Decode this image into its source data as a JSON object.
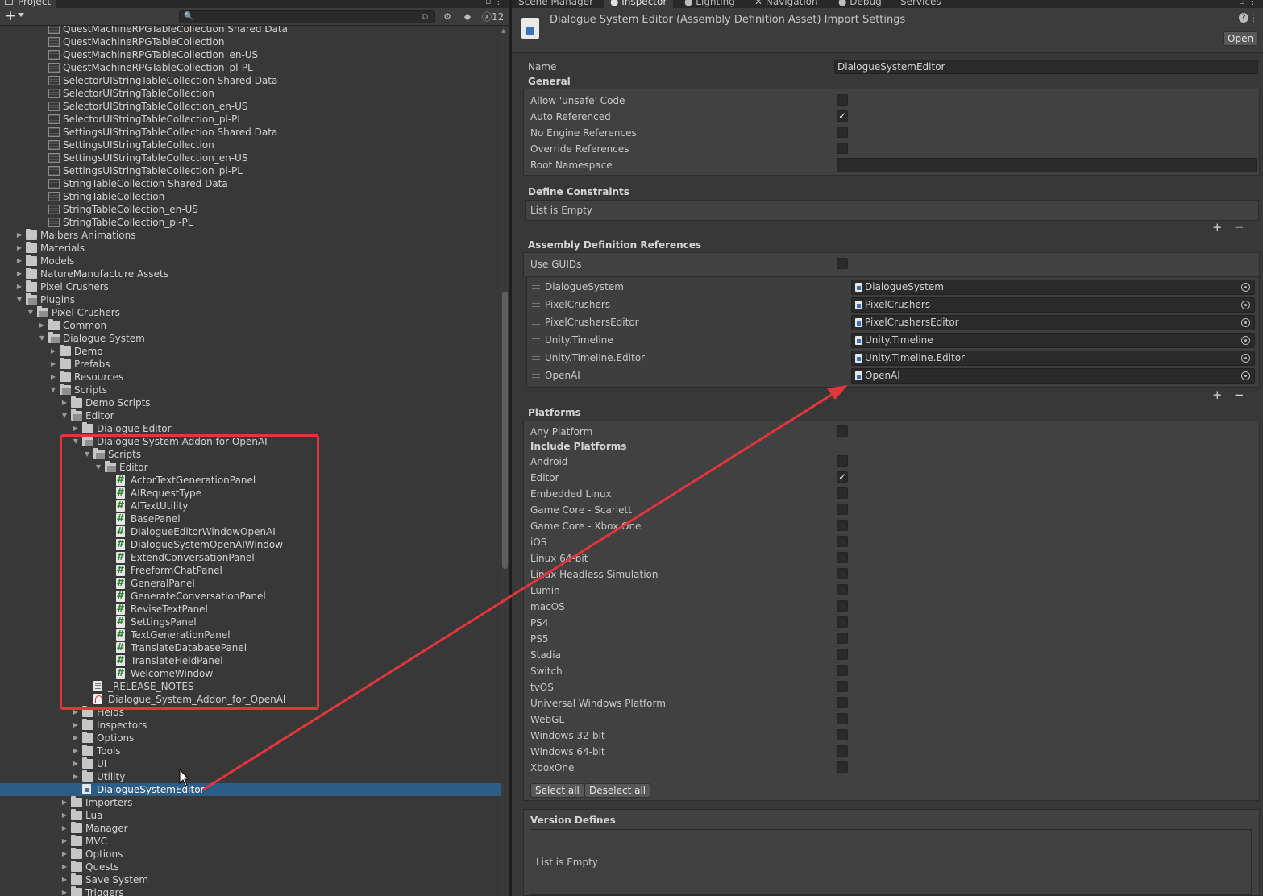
{
  "left_panel": {
    "tab_title": "Project",
    "hidden_count": "12",
    "tree": [
      {
        "label": "QuestMachineRPGTableCollection Shared Data",
        "icon": "table-icon",
        "depth": 3,
        "arrow": ""
      },
      {
        "label": "QuestMachineRPGTableCollection",
        "icon": "table-icon",
        "depth": 3,
        "arrow": ""
      },
      {
        "label": "QuestMachineRPGTableCollection_en-US",
        "icon": "table-icon",
        "depth": 3,
        "arrow": ""
      },
      {
        "label": "QuestMachineRPGTableCollection_pl-PL",
        "icon": "table-icon",
        "depth": 3,
        "arrow": ""
      },
      {
        "label": "SelectorUIStringTableCollection Shared Data",
        "icon": "table-icon",
        "depth": 3,
        "arrow": ""
      },
      {
        "label": "SelectorUIStringTableCollection",
        "icon": "table-icon",
        "depth": 3,
        "arrow": ""
      },
      {
        "label": "SelectorUIStringTableCollection_en-US",
        "icon": "table-icon",
        "depth": 3,
        "arrow": ""
      },
      {
        "label": "SelectorUIStringTableCollection_pl-PL",
        "icon": "table-icon",
        "depth": 3,
        "arrow": ""
      },
      {
        "label": "SettingsUIStringTableCollection Shared Data",
        "icon": "table-icon",
        "depth": 3,
        "arrow": ""
      },
      {
        "label": "SettingsUIStringTableCollection",
        "icon": "table-icon",
        "depth": 3,
        "arrow": ""
      },
      {
        "label": "SettingsUIStringTableCollection_en-US",
        "icon": "table-icon",
        "depth": 3,
        "arrow": ""
      },
      {
        "label": "SettingsUIStringTableCollection_pl-PL",
        "icon": "table-icon",
        "depth": 3,
        "arrow": ""
      },
      {
        "label": "StringTableCollection Shared Data",
        "icon": "table-icon",
        "depth": 3,
        "arrow": ""
      },
      {
        "label": "StringTableCollection",
        "icon": "table-icon",
        "depth": 3,
        "arrow": ""
      },
      {
        "label": "StringTableCollection_en-US",
        "icon": "table-icon",
        "depth": 3,
        "arrow": ""
      },
      {
        "label": "StringTableCollection_pl-PL",
        "icon": "table-icon",
        "depth": 3,
        "arrow": ""
      },
      {
        "label": "Malbers Animations",
        "icon": "folder-icon",
        "depth": 1,
        "arrow": "right"
      },
      {
        "label": "Materials",
        "icon": "folder-icon",
        "depth": 1,
        "arrow": "right"
      },
      {
        "label": "Models",
        "icon": "folder-icon",
        "depth": 1,
        "arrow": "right"
      },
      {
        "label": "NatureManufacture Assets",
        "icon": "folder-icon",
        "depth": 1,
        "arrow": "right"
      },
      {
        "label": "Pixel Crushers",
        "icon": "folder-icon",
        "depth": 1,
        "arrow": "right"
      },
      {
        "label": "Plugins",
        "icon": "folder-open-icon",
        "depth": 1,
        "arrow": "down"
      },
      {
        "label": "Pixel Crushers",
        "icon": "folder-open-icon",
        "depth": 2,
        "arrow": "down"
      },
      {
        "label": "Common",
        "icon": "folder-icon",
        "depth": 3,
        "arrow": "right"
      },
      {
        "label": "Dialogue System",
        "icon": "folder-open-icon",
        "depth": 3,
        "arrow": "down"
      },
      {
        "label": "Demo",
        "icon": "folder-icon",
        "depth": 4,
        "arrow": "right"
      },
      {
        "label": "Prefabs",
        "icon": "folder-icon",
        "depth": 4,
        "arrow": "right"
      },
      {
        "label": "Resources",
        "icon": "folder-icon",
        "depth": 4,
        "arrow": "right"
      },
      {
        "label": "Scripts",
        "icon": "folder-open-icon",
        "depth": 4,
        "arrow": "down"
      },
      {
        "label": "Demo Scripts",
        "icon": "folder-icon",
        "depth": 5,
        "arrow": "right"
      },
      {
        "label": "Editor",
        "icon": "folder-open-icon",
        "depth": 5,
        "arrow": "down"
      },
      {
        "label": "Dialogue Editor",
        "icon": "folder-icon",
        "depth": 6,
        "arrow": "right"
      },
      {
        "label": "Dialogue System Addon for OpenAI",
        "icon": "folder-open-icon",
        "depth": 6,
        "arrow": "down"
      },
      {
        "label": "Scripts",
        "icon": "folder-open-icon",
        "depth": 7,
        "arrow": "down"
      },
      {
        "label": "Editor",
        "icon": "folder-open-icon",
        "depth": 8,
        "arrow": "down"
      },
      {
        "label": "ActorTextGenerationPanel",
        "icon": "csharp-icon",
        "depth": 9,
        "arrow": ""
      },
      {
        "label": "AIRequestType",
        "icon": "csharp-icon",
        "depth": 9,
        "arrow": ""
      },
      {
        "label": "AITextUtility",
        "icon": "csharp-icon",
        "depth": 9,
        "arrow": ""
      },
      {
        "label": "BasePanel",
        "icon": "csharp-icon",
        "depth": 9,
        "arrow": ""
      },
      {
        "label": "DialogueEditorWindowOpenAI",
        "icon": "csharp-icon",
        "depth": 9,
        "arrow": ""
      },
      {
        "label": "DialogueSystemOpenAIWindow",
        "icon": "csharp-icon",
        "depth": 9,
        "arrow": ""
      },
      {
        "label": "ExtendConversationPanel",
        "icon": "csharp-icon",
        "depth": 9,
        "arrow": ""
      },
      {
        "label": "FreeformChatPanel",
        "icon": "csharp-icon",
        "depth": 9,
        "arrow": ""
      },
      {
        "label": "GeneralPanel",
        "icon": "csharp-icon",
        "depth": 9,
        "arrow": ""
      },
      {
        "label": "GenerateConversationPanel",
        "icon": "csharp-icon",
        "depth": 9,
        "arrow": ""
      },
      {
        "label": "ReviseTextPanel",
        "icon": "csharp-icon",
        "depth": 9,
        "arrow": ""
      },
      {
        "label": "SettingsPanel",
        "icon": "csharp-icon",
        "depth": 9,
        "arrow": ""
      },
      {
        "label": "TextGenerationPanel",
        "icon": "csharp-icon",
        "depth": 9,
        "arrow": ""
      },
      {
        "label": "TranslateDatabasePanel",
        "icon": "csharp-icon",
        "depth": 9,
        "arrow": ""
      },
      {
        "label": "TranslateFieldPanel",
        "icon": "csharp-icon",
        "depth": 9,
        "arrow": ""
      },
      {
        "label": "WelcomeWindow",
        "icon": "csharp-icon",
        "depth": 9,
        "arrow": ""
      },
      {
        "label": "_RELEASE_NOTES",
        "icon": "text-file-icon",
        "depth": 7,
        "arrow": ""
      },
      {
        "label": "Dialogue_System_Addon_for_OpenAI",
        "icon": "pdf-icon",
        "depth": 7,
        "arrow": ""
      },
      {
        "label": "Fields",
        "icon": "folder-icon",
        "depth": 6,
        "arrow": "right"
      },
      {
        "label": "Inspectors",
        "icon": "folder-icon",
        "depth": 6,
        "arrow": "right"
      },
      {
        "label": "Options",
        "icon": "folder-icon",
        "depth": 6,
        "arrow": "right"
      },
      {
        "label": "Tools",
        "icon": "folder-icon",
        "depth": 6,
        "arrow": "right"
      },
      {
        "label": "UI",
        "icon": "folder-icon",
        "depth": 6,
        "arrow": "right"
      },
      {
        "label": "Utility",
        "icon": "folder-icon",
        "depth": 6,
        "arrow": "right"
      },
      {
        "label": "DialogueSystemEditor",
        "icon": "assembly-definition-icon",
        "depth": 6,
        "arrow": "",
        "selected": true
      },
      {
        "label": "Importers",
        "icon": "folder-icon",
        "depth": 5,
        "arrow": "right"
      },
      {
        "label": "Lua",
        "icon": "folder-icon",
        "depth": 5,
        "arrow": "right"
      },
      {
        "label": "Manager",
        "icon": "folder-icon",
        "depth": 5,
        "arrow": "right"
      },
      {
        "label": "MVC",
        "icon": "folder-icon",
        "depth": 5,
        "arrow": "right"
      },
      {
        "label": "Options",
        "icon": "folder-icon",
        "depth": 5,
        "arrow": "right"
      },
      {
        "label": "Quests",
        "icon": "folder-icon",
        "depth": 5,
        "arrow": "right"
      },
      {
        "label": "Save System",
        "icon": "folder-icon",
        "depth": 5,
        "arrow": "right"
      },
      {
        "label": "Triggers",
        "icon": "folder-icon",
        "depth": 5,
        "arrow": "right"
      }
    ]
  },
  "right_panel": {
    "tabs": [
      "Scene Manager",
      "Inspector",
      "Lighting",
      "Navigation",
      "Debug",
      "Services"
    ],
    "active_tab": "Inspector",
    "header_title": "Dialogue System Editor (Assembly Definition Asset) Import Settings",
    "open_button": "Open",
    "name_label": "Name",
    "name_value": "DialogueSystemEditor",
    "general_heading": "General",
    "general_options": [
      {
        "label": "Allow 'unsafe' Code",
        "checked": false
      },
      {
        "label": "Auto Referenced",
        "checked": true
      },
      {
        "label": "No Engine References",
        "checked": false
      },
      {
        "label": "Override References",
        "checked": false
      }
    ],
    "root_namespace_label": "Root Namespace",
    "root_namespace_value": "",
    "define_constraints_heading": "Define Constraints",
    "define_constraints_empty": "List is Empty",
    "asm_refs_heading": "Assembly Definition References",
    "use_guids_label": "Use GUIDs",
    "use_guids_checked": false,
    "references": [
      {
        "name": "DialogueSystem",
        "value": "DialogueSystem"
      },
      {
        "name": "PixelCrushers",
        "value": "PixelCrushers"
      },
      {
        "name": "PixelCrushersEditor",
        "value": "PixelCrushersEditor"
      },
      {
        "name": "Unity.Timeline",
        "value": "Unity.Timeline"
      },
      {
        "name": "Unity.Timeline.Editor",
        "value": "Unity.Timeline.Editor"
      },
      {
        "name": "OpenAI",
        "value": "OpenAI"
      }
    ],
    "platforms_heading": "Platforms",
    "any_platform_label": "Any Platform",
    "any_platform_checked": false,
    "include_platforms_label": "Include Platforms",
    "platforms": [
      {
        "label": "Android",
        "checked": false
      },
      {
        "label": "Editor",
        "checked": true
      },
      {
        "label": "Embedded Linux",
        "checked": false
      },
      {
        "label": "Game Core - Scarlett",
        "checked": false
      },
      {
        "label": "Game Core - Xbox One",
        "checked": false
      },
      {
        "label": "iOS",
        "checked": false
      },
      {
        "label": "Linux 64-bit",
        "checked": false
      },
      {
        "label": "Linux Headless Simulation",
        "checked": false
      },
      {
        "label": "Lumin",
        "checked": false
      },
      {
        "label": "macOS",
        "checked": false
      },
      {
        "label": "PS4",
        "checked": false
      },
      {
        "label": "PS5",
        "checked": false
      },
      {
        "label": "Stadia",
        "checked": false
      },
      {
        "label": "Switch",
        "checked": false
      },
      {
        "label": "tvOS",
        "checked": false
      },
      {
        "label": "Universal Windows Platform",
        "checked": false
      },
      {
        "label": "WebGL",
        "checked": false
      },
      {
        "label": "Windows 32-bit",
        "checked": false
      },
      {
        "label": "Windows 64-bit",
        "checked": false
      },
      {
        "label": "XboxOne",
        "checked": false
      }
    ],
    "select_all": "Select all",
    "deselect_all": "Deselect all",
    "version_defines_heading": "Version Defines",
    "version_defines_empty": "List is Empty"
  },
  "colors": {
    "annotation_red": "#e3353b",
    "selection_blue": "#2c5d87"
  }
}
